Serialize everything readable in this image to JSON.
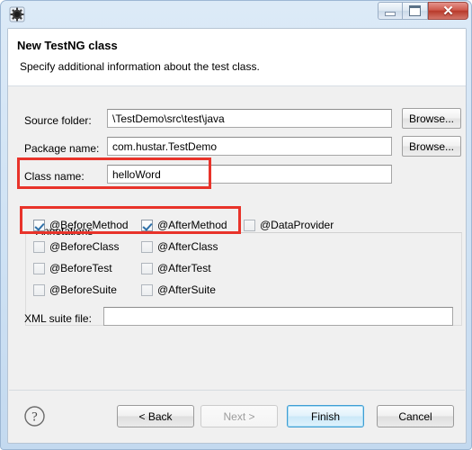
{
  "window": {
    "icon": "testng-gear-icon",
    "controls": {
      "minimize": "minimize-icon",
      "maximize": "maximize-icon",
      "close_label": "✕"
    }
  },
  "header": {
    "title": "New TestNG class",
    "subtitle": "Specify additional information about the test class."
  },
  "form": {
    "source_folder": {
      "label": "Source folder:",
      "value": "\\TestDemo\\src\\test\\java",
      "browse_label": "Browse..."
    },
    "package_name": {
      "label": "Package name:",
      "value": "com.hustar.TestDemo",
      "browse_label": "Browse..."
    },
    "class_name": {
      "label": "Class name:",
      "value": "helloWord"
    },
    "xml_suite_file": {
      "label": "XML suite file:",
      "value": ""
    }
  },
  "annotations": {
    "group_title": "Annotations",
    "items": [
      {
        "label": "@BeforeMethod",
        "checked": true
      },
      {
        "label": "@AfterMethod",
        "checked": true
      },
      {
        "label": "@DataProvider",
        "checked": false
      },
      {
        "label": "@BeforeClass",
        "checked": false
      },
      {
        "label": "@AfterClass",
        "checked": false
      },
      {
        "label": "@BeforeTest",
        "checked": false
      },
      {
        "label": "@AfterTest",
        "checked": false
      },
      {
        "label": "@BeforeSuite",
        "checked": false
      },
      {
        "label": "@AfterSuite",
        "checked": false
      }
    ]
  },
  "buttons": {
    "help": "help-icon",
    "back": "< Back",
    "next": "Next >",
    "finish": "Finish",
    "cancel": "Cancel"
  },
  "highlights": {
    "color": "#e8332a",
    "regions": [
      "class-name-row",
      "method-annotations-row"
    ]
  }
}
